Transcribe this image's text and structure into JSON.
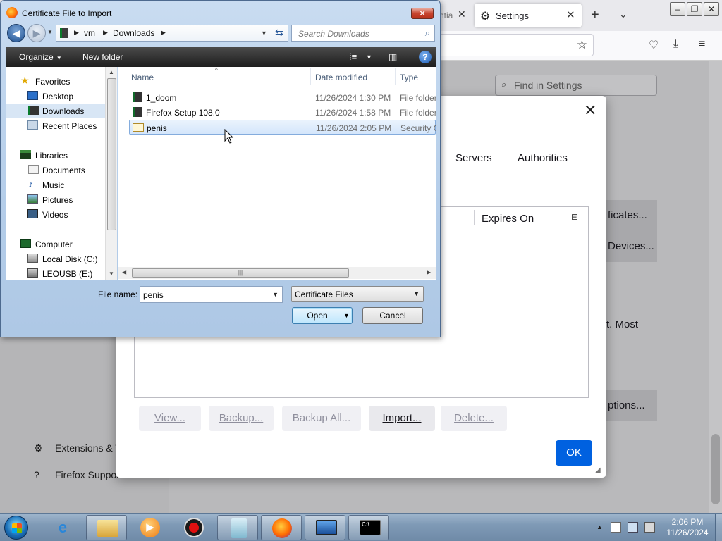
{
  "firefox": {
    "prev_tab_text": "ntia",
    "active_tab_title": "Settings",
    "find_placeholder": "Find in Settings",
    "sidebar": {
      "extensions_label": "Extensions & T",
      "support_label": "Firefox Suppor"
    },
    "bg_fragments": {
      "certificates_btn": "ficates...",
      "devices_btn": "Devices...",
      "most_text": "t. Most",
      "options_btn": "ptions..."
    }
  },
  "cert_manager": {
    "tabs": [
      "Servers",
      "Authorities"
    ],
    "columns": {
      "expires_on": "Expires On"
    },
    "buttons": {
      "view": "View...",
      "backup": "Backup...",
      "backup_all": "Backup All...",
      "import": "Import...",
      "delete": "Delete..."
    },
    "ok_label": "OK"
  },
  "file_dialog": {
    "title": "Certificate File to Import",
    "breadcrumb": [
      "vm",
      "Downloads"
    ],
    "search_placeholder": "Search Downloads",
    "toolbar": {
      "organize": "Organize",
      "new_folder": "New folder"
    },
    "nav": {
      "favorites": "Favorites",
      "desktop": "Desktop",
      "downloads": "Downloads",
      "recent_places": "Recent Places",
      "libraries": "Libraries",
      "documents": "Documents",
      "music": "Music",
      "pictures": "Pictures",
      "videos": "Videos",
      "computer": "Computer",
      "local_disk": "Local Disk (C:)",
      "usb": "LEOUSB (E:)"
    },
    "columns": {
      "name": "Name",
      "date_modified": "Date modified",
      "type": "Type"
    },
    "files": [
      {
        "name": "1_doom",
        "date": "11/26/2024 1:30 PM",
        "type": "File folder"
      },
      {
        "name": "Firefox Setup 108.0",
        "date": "11/26/2024 1:58 PM",
        "type": "File folder"
      },
      {
        "name": "penis",
        "date": "11/26/2024 2:05 PM",
        "type": "Security C"
      }
    ],
    "file_name_label": "File name:",
    "file_name_value": "penis",
    "file_type_value": "Certificate Files",
    "open_label": "Open",
    "cancel_label": "Cancel"
  },
  "taskbar": {
    "clock_time": "2:06 PM",
    "clock_date": "11/26/2024"
  }
}
